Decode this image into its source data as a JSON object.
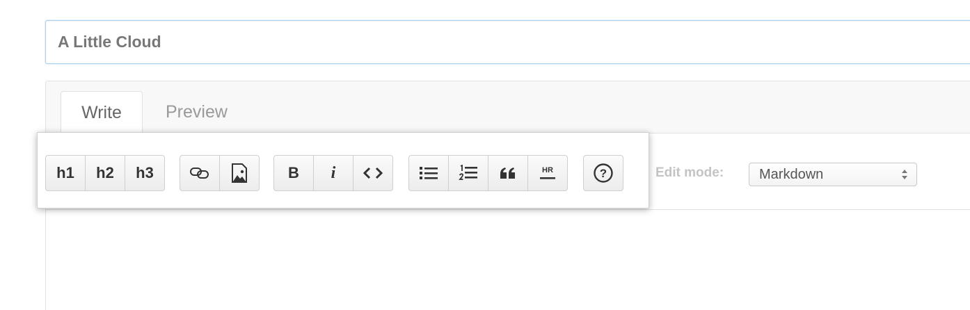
{
  "title_field": {
    "value": "A Little Cloud"
  },
  "tabs": [
    {
      "label": "Write",
      "active": true
    },
    {
      "label": "Preview",
      "active": false
    }
  ],
  "edit_mode": {
    "label": "Edit mode:",
    "selected": "Markdown"
  },
  "toolbar": {
    "headings": [
      {
        "label": "h1",
        "icon": "heading-1"
      },
      {
        "label": "h2",
        "icon": "heading-2"
      },
      {
        "label": "h3",
        "icon": "heading-3"
      }
    ],
    "insert": [
      {
        "icon": "link-icon"
      },
      {
        "icon": "image-icon"
      }
    ],
    "format": [
      {
        "label": "B",
        "icon": "bold"
      },
      {
        "label": "i",
        "icon": "italic"
      },
      {
        "icon": "code-icon"
      }
    ],
    "blocks": [
      {
        "icon": "bullet-list-icon"
      },
      {
        "icon": "numbered-list-icon"
      },
      {
        "icon": "quote-icon"
      },
      {
        "icon": "horizontal-rule-icon",
        "label": "HR"
      }
    ],
    "help": {
      "icon": "help-icon"
    }
  },
  "colors": {
    "focus_border": "#a9d3f1",
    "tab_text": "#9a9a9a",
    "icon": "#333333"
  }
}
